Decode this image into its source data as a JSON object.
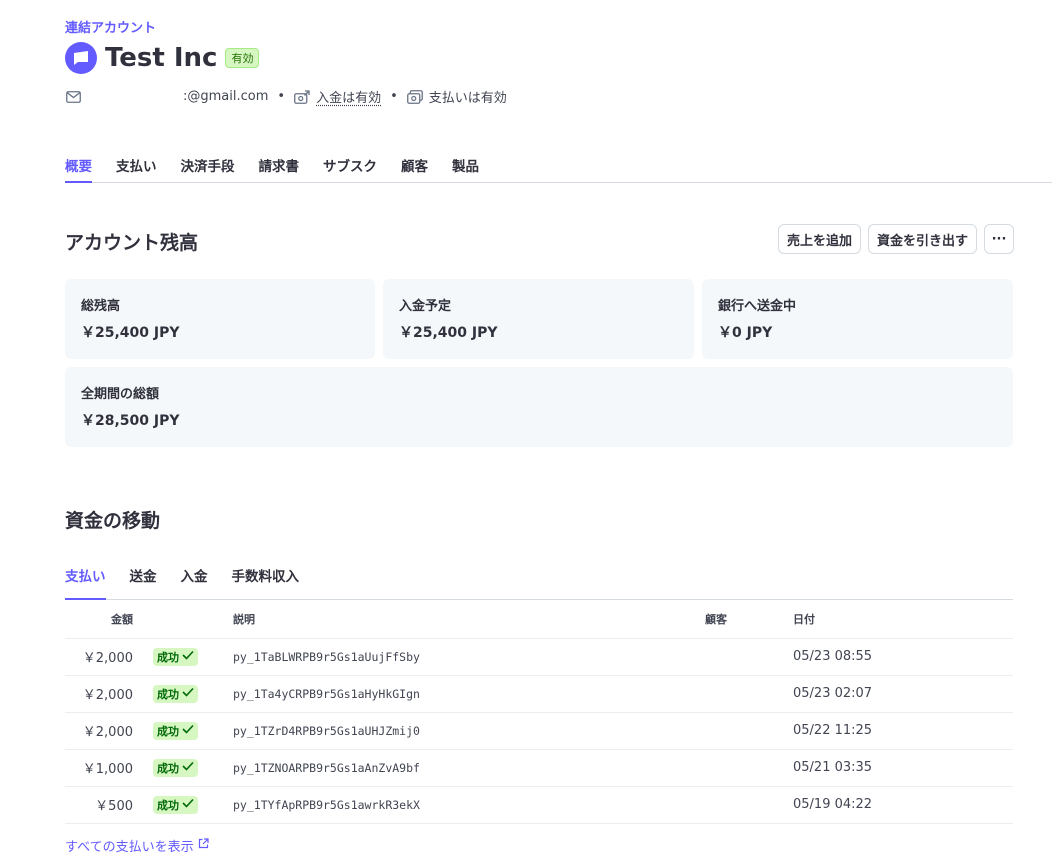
{
  "header": {
    "eyebrow": "連結アカウント",
    "title": "Test Inc",
    "badge": "有効",
    "email": ":@gmail.com",
    "payouts_status": "入金は有効",
    "payments_status": "支払いは有効"
  },
  "nav": {
    "tabs": [
      "概要",
      "支払い",
      "決済手段",
      "請求書",
      "サブスク",
      "顧客",
      "製品"
    ]
  },
  "balance": {
    "heading": "アカウント残高",
    "actions": {
      "add_sales": "売上を追加",
      "withdraw": "資金を引き出す",
      "more": "···"
    },
    "cards": [
      {
        "label": "総残高",
        "value": "￥25,400 JPY"
      },
      {
        "label": "入金予定",
        "value": "￥25,400 JPY"
      },
      {
        "label": "銀行へ送金中",
        "value": "￥0 JPY"
      },
      {
        "label": "全期間の総額",
        "value": "￥28,500 JPY"
      }
    ]
  },
  "movements": {
    "heading": "資金の移動",
    "tabs": [
      "支払い",
      "送金",
      "入金",
      "手数料収入"
    ],
    "columns": {
      "amount": "金額",
      "description": "説明",
      "customer": "顧客",
      "date": "日付"
    },
    "rows": [
      {
        "amount": "￥2,000",
        "status": "成功",
        "description": "py_1TaBLWRPB9r5Gs1aUujFfSby",
        "customer": "",
        "date": "05/23 08:55"
      },
      {
        "amount": "￥2,000",
        "status": "成功",
        "description": "py_1Ta4yCRPB9r5Gs1aHyHkGIgn",
        "customer": "",
        "date": "05/23 02:07"
      },
      {
        "amount": "￥2,000",
        "status": "成功",
        "description": "py_1TZrD4RPB9r5Gs1aUHJZmij0",
        "customer": "",
        "date": "05/22 11:25"
      },
      {
        "amount": "￥1,000",
        "status": "成功",
        "description": "py_1TZNOARPB9r5Gs1aAnZvA9bf",
        "customer": "",
        "date": "05/21 03:35"
      },
      {
        "amount": "￥500",
        "status": "成功",
        "description": "py_1TYfApRPB9r5Gs1awrkR3ekX",
        "customer": "",
        "date": "05/19 04:22"
      }
    ],
    "view_all": "すべての支払いを表示"
  },
  "colors": {
    "accent": "#635bff",
    "success_bg": "#d7f7c2",
    "success_text": "#006908",
    "card_bg": "#f5f8fa"
  },
  "icons": [
    "logo-icon",
    "mail-icon",
    "payout-icon",
    "payments-icon",
    "check-icon",
    "external-link-icon"
  ]
}
